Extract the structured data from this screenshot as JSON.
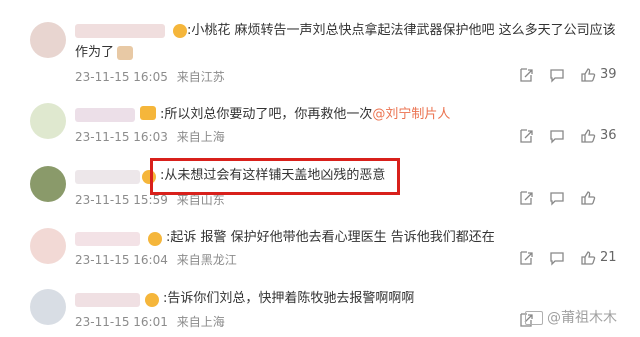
{
  "comments": [
    {
      "text": ":小桃花 麻烦转告一声刘总快点拿起法律武器保护他吧 这么多天了公司应该",
      "text2": "作为了",
      "time": "23-11-15 16:05",
      "location": "来自江苏",
      "likes": "39"
    },
    {
      "text": ":所以刘总你要动了吧，你再救他一次",
      "mention": "@刘宁制片人",
      "time": "23-11-15 16:03",
      "location": "来自上海",
      "likes": "36"
    },
    {
      "text": ":从未想过会有这样铺天盖地凶残的恶意",
      "time": "23-11-15 15:59",
      "location": "来自山东",
      "likes": ""
    },
    {
      "text": ":起诉 报警 保护好他带他去看心理医生 告诉他我们都还在",
      "time": "23-11-15 16:04",
      "location": "来自黑龙江",
      "likes": "21"
    },
    {
      "text": ":告诉你们刘总，快押着陈牧驰去报警啊啊啊",
      "time": "23-11-15 16:01",
      "location": "来自上海",
      "likes": ""
    }
  ],
  "icons": {
    "forward": "forward-icon",
    "comment": "comment-icon",
    "like": "thumbs-up-icon"
  },
  "watermark": "@莆祖木木",
  "colors": {
    "highlight": "#d8201b",
    "mention": "#eb7350",
    "meta": "#8c8c8c"
  }
}
